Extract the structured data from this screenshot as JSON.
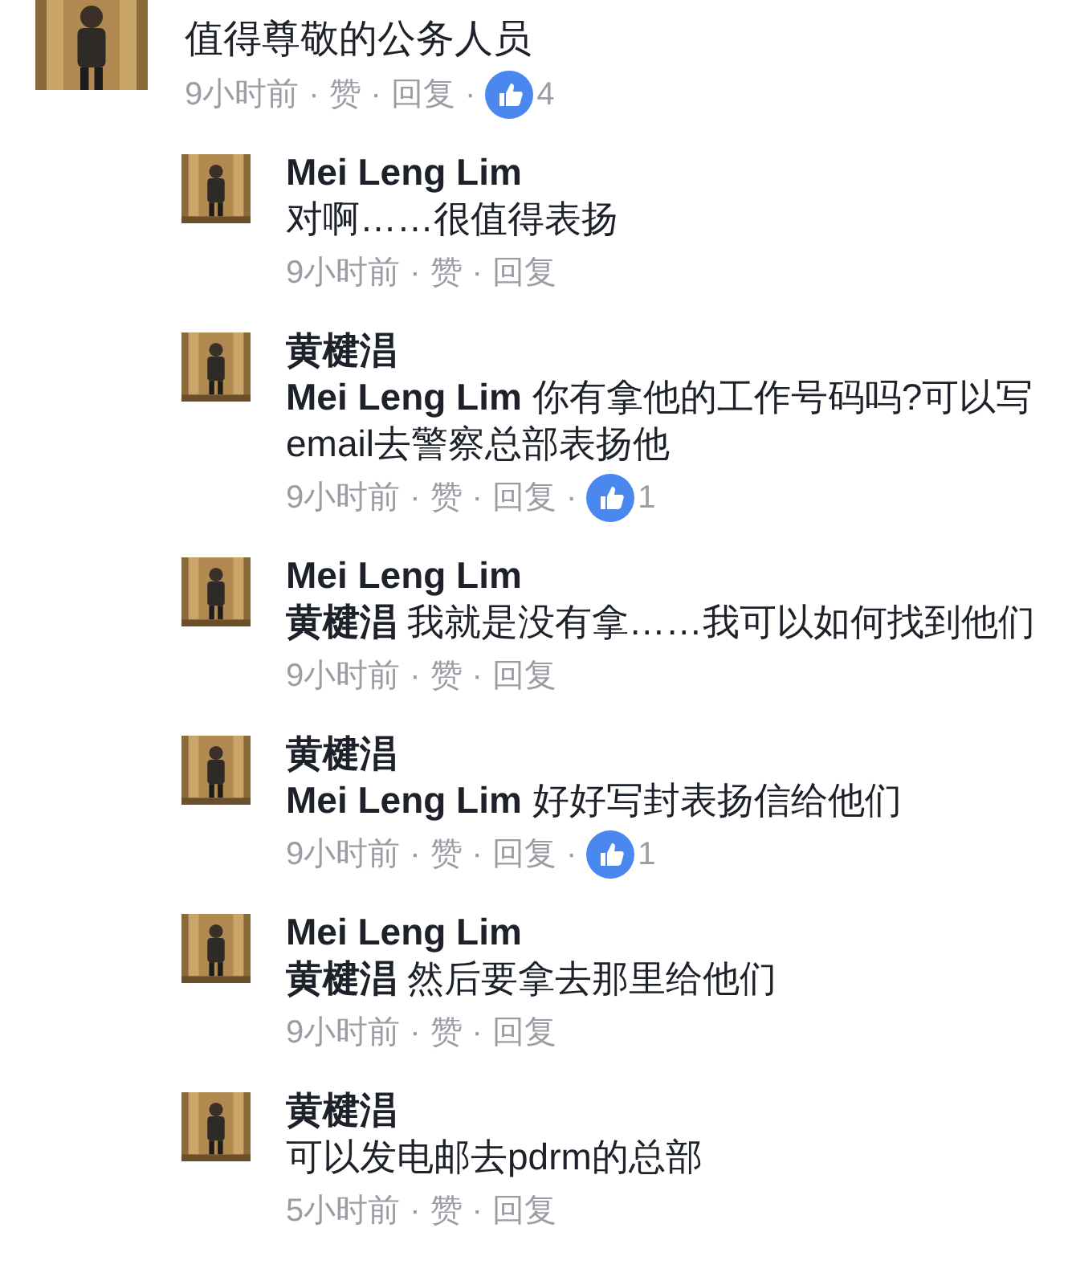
{
  "separator": "·",
  "comment": {
    "body": "值得尊敬的公务人员",
    "meta": {
      "time": "9小时前",
      "like": "赞",
      "reply": "回复",
      "reactions": "4"
    }
  },
  "replies": [
    {
      "name": "Mei Leng Lim",
      "body": "对啊……很值得表扬",
      "meta": {
        "time": "9小时前",
        "like": "赞",
        "reply": "回复"
      }
    },
    {
      "name": "黄楗淐",
      "body": "**Mei Leng Lim** 你有拿他的工作号码吗?可以写email去警察总部表扬他",
      "meta": {
        "time": "9小时前",
        "like": "赞",
        "reply": "回复",
        "reactions": "1"
      }
    },
    {
      "name": "Mei Leng Lim",
      "body": "**黄楗淐** 我就是没有拿……我可以如何找到他们",
      "meta": {
        "time": "9小时前",
        "like": "赞",
        "reply": "回复"
      }
    },
    {
      "name": "黄楗淐",
      "body": "**Mei Leng Lim** 好好写封表扬信给他们",
      "meta": {
        "time": "9小时前",
        "like": "赞",
        "reply": "回复",
        "reactions": "1"
      }
    },
    {
      "name": "Mei Leng Lim",
      "body": "**黄楗淐** 然后要拿去那里给他们",
      "meta": {
        "time": "9小时前",
        "like": "赞",
        "reply": "回复"
      }
    },
    {
      "name": "黄楗淐",
      "body": "可以发电邮去pdrm的总部",
      "meta": {
        "time": "5小时前",
        "like": "赞",
        "reply": "回复"
      }
    }
  ]
}
